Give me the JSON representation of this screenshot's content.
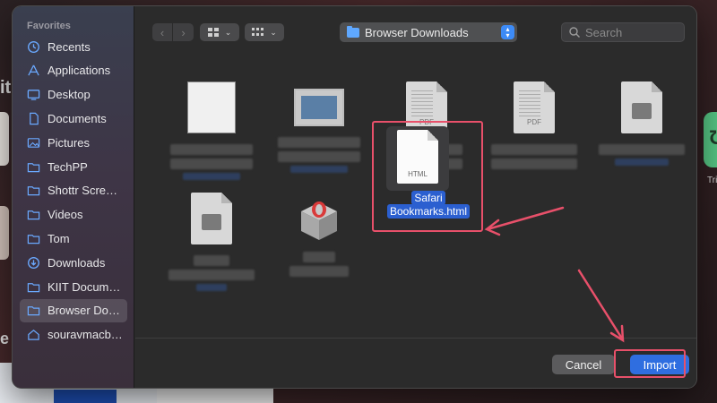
{
  "sidebar": {
    "heading": "Favorites",
    "items": [
      {
        "label": "Recents",
        "icon": "clock-icon"
      },
      {
        "label": "Applications",
        "icon": "applications-icon"
      },
      {
        "label": "Desktop",
        "icon": "desktop-icon"
      },
      {
        "label": "Documents",
        "icon": "document-icon"
      },
      {
        "label": "Pictures",
        "icon": "pictures-icon"
      },
      {
        "label": "TechPP",
        "icon": "folder-icon"
      },
      {
        "label": "Shottr Scre…",
        "icon": "folder-icon"
      },
      {
        "label": "Videos",
        "icon": "folder-icon"
      },
      {
        "label": "Tom",
        "icon": "folder-icon"
      },
      {
        "label": "Downloads",
        "icon": "download-icon"
      },
      {
        "label": "KIIT Docum…",
        "icon": "folder-icon"
      },
      {
        "label": "Browser Do…",
        "icon": "folder-icon",
        "active": true
      },
      {
        "label": "souravmacb…",
        "icon": "home-icon"
      }
    ]
  },
  "toolbar": {
    "back": "‹",
    "forward": "›",
    "path": "Browser Downloads",
    "search_placeholder": "Search"
  },
  "files": {
    "pdf_label": "PDF",
    "html_label": "HTML",
    "selected_line1": "Safari",
    "selected_line2": "Bookmarks.html"
  },
  "footer": {
    "cancel": "Cancel",
    "import": "Import"
  },
  "colors": {
    "accent": "#2f6ee0",
    "annotation": "#e8506a"
  }
}
